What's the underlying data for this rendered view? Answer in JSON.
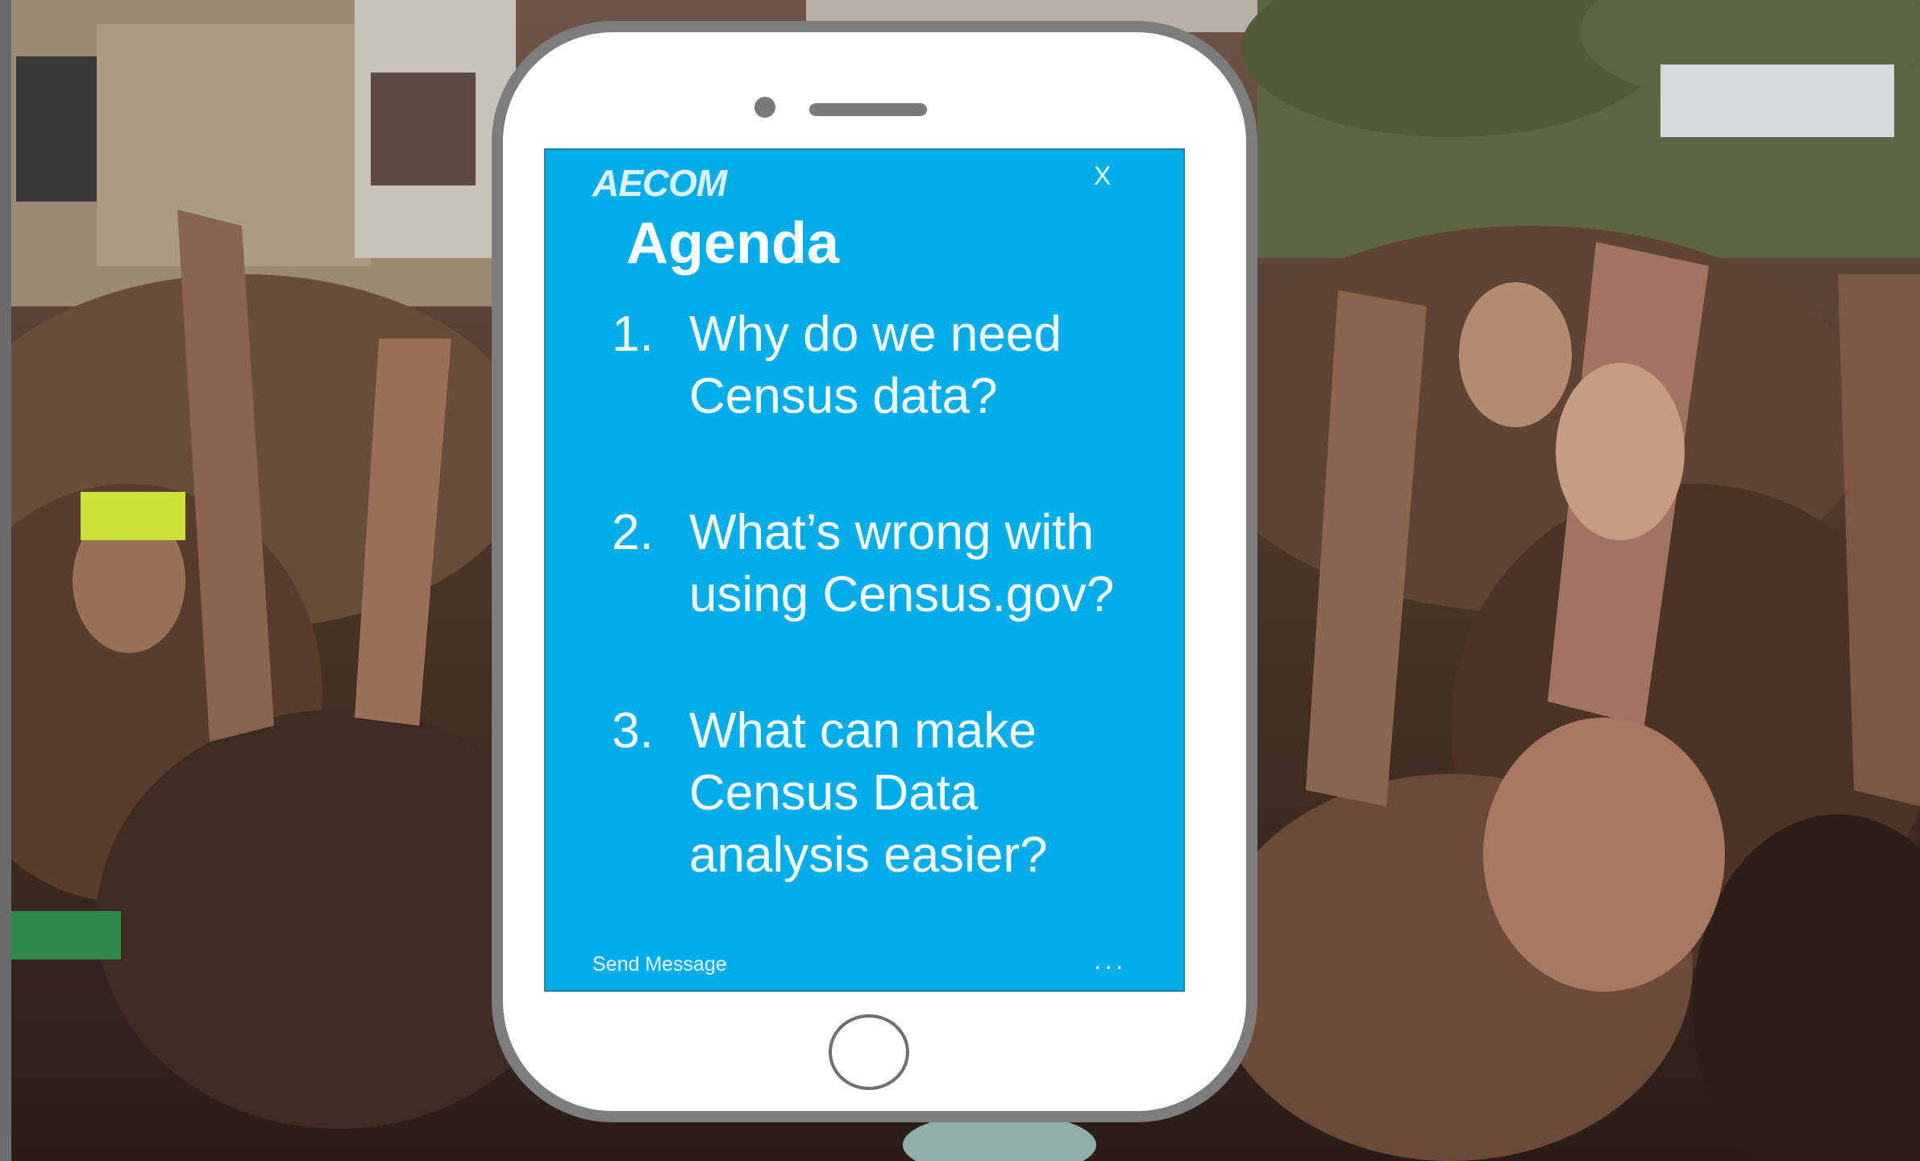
{
  "background": {
    "subject": "crowd-photo"
  },
  "phone": {
    "frame_color": "#7d7d7d"
  },
  "screen": {
    "background_color": "#00adeb",
    "logo_text": "AECOM",
    "close_label": "X",
    "title": "Agenda",
    "items": [
      {
        "number": "1.",
        "lines": [
          "Why do we need",
          "Census data?"
        ]
      },
      {
        "number": "2.",
        "lines": [
          "What’s wrong with",
          "using Census.gov?"
        ]
      },
      {
        "number": "3.",
        "lines": [
          "What can make",
          "Census Data",
          "analysis easier?"
        ]
      }
    ],
    "send_message_label": "Send Message",
    "more_label": "..."
  }
}
